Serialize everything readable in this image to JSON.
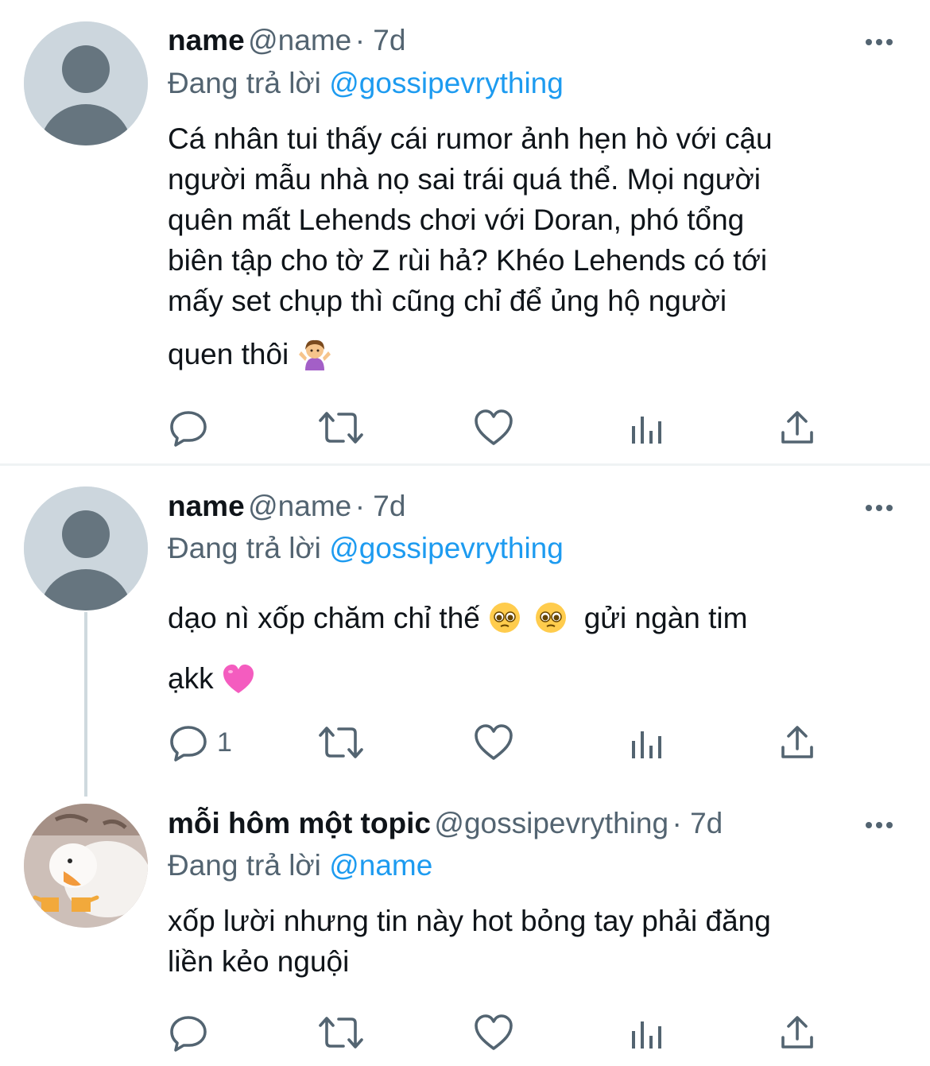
{
  "tweets": [
    {
      "name": "name",
      "handle": "@name",
      "time": "· 7d",
      "replying_prefix": "Đang trả lời",
      "replying_to": "@gossipevrything",
      "lines": [
        "Cá nhân tui thấy cái rumor ảnh hẹn hò với cậu",
        "người mẫu nhà nọ sai trái quá thể. Mọi người",
        "quên mất Lehends chơi với Doran, phó tổng",
        "biên tập cho tờ Z rùi hả? Khéo Lehends có tới",
        "mấy set chụp thì cũng chỉ để ủng hộ người",
        "quen thôi"
      ],
      "emoji": "person-shrugging-emoji",
      "reply_count": ""
    },
    {
      "name": "name",
      "handle": "@name",
      "time": "· 7d",
      "replying_prefix": "Đang trả lời",
      "replying_to": "@gossipevrything",
      "line1_a": "dạo nì xốp chăm chỉ thế",
      "line1_b": "gửi ngàn tim",
      "line2": "ạkk",
      "emojis": [
        "pleading-face-emoji",
        "pleading-face-emoji",
        "pink-heart-emoji"
      ],
      "reply_count": "1"
    },
    {
      "name": "mỗi hôm một topic",
      "handle": "@gossipevrything",
      "time": "· 7d",
      "replying_prefix": "Đang trả lời",
      "replying_to": "@name",
      "lines": [
        "xốp lười nhưng tin này hot bỏng tay phải đăng",
        "liền kẻo nguội"
      ],
      "reply_count": ""
    }
  ],
  "icons": [
    "reply-icon",
    "retweet-icon",
    "like-icon",
    "analytics-icon",
    "share-icon",
    "more-icon"
  ],
  "colors": {
    "accent": "#1d9bf0",
    "secondary_text": "#536471",
    "avatar_bg": "#ccd6dd",
    "avatar_fg": "#66757f"
  }
}
